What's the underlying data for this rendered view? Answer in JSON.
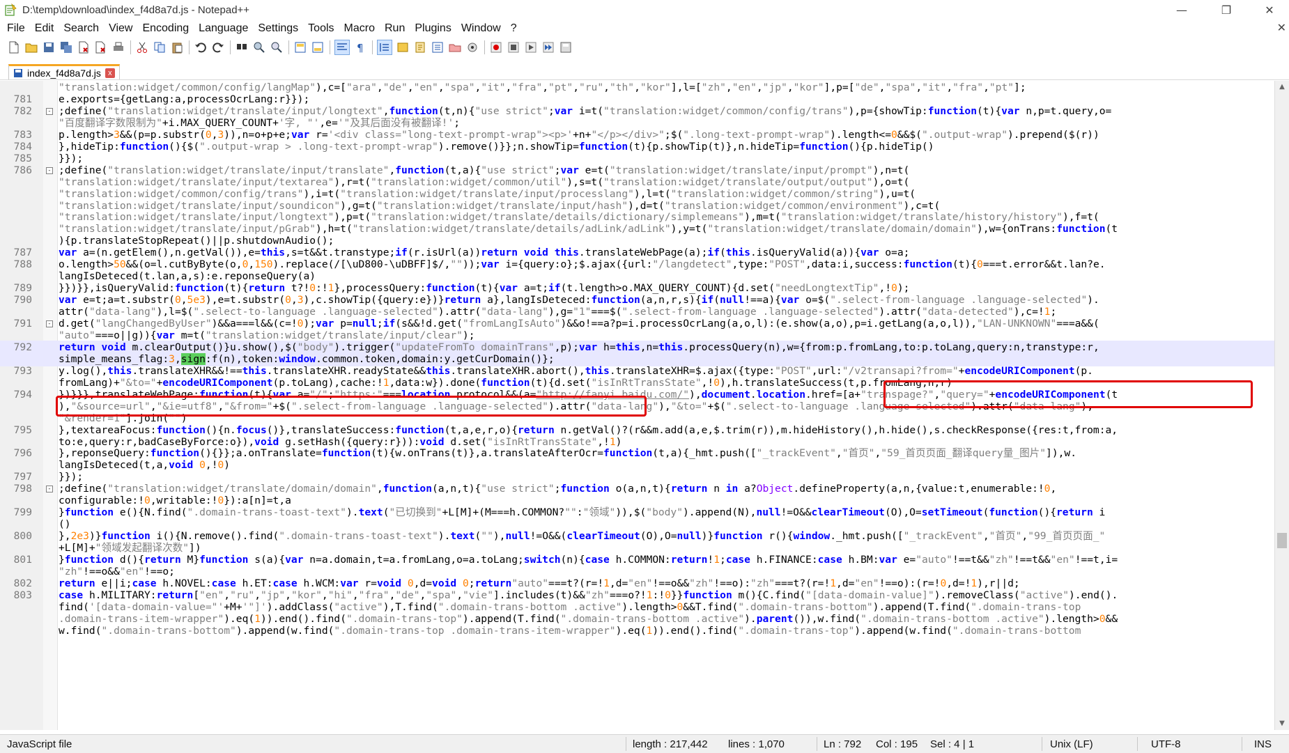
{
  "window": {
    "title": "D:\\temp\\download\\index_f4d8a7d.js - Notepad++",
    "controls": {
      "minimize": "—",
      "maximize": "❐",
      "close": "✕"
    }
  },
  "menu": {
    "items": [
      "File",
      "Edit",
      "Search",
      "View",
      "Encoding",
      "Language",
      "Settings",
      "Tools",
      "Macro",
      "Run",
      "Plugins",
      "Window",
      "?"
    ],
    "close_glyph": "✕"
  },
  "toolbar": {
    "icons": [
      "new-file-icon",
      "open-file-icon",
      "save-icon",
      "save-all-icon",
      "close-icon",
      "close-all-icon",
      "print-icon",
      "cut-icon",
      "copy-icon",
      "paste-icon",
      "undo-icon",
      "redo-icon",
      "find-icon",
      "replace-icon",
      "zoom-in-icon",
      "zoom-out-icon",
      "sync-vertical-icon",
      "sync-horizontal-icon",
      "word-wrap-icon",
      "show-all-chars-icon",
      "indent-guide-icon",
      "user-lang-icon",
      "doc-map-icon",
      "function-list-icon",
      "folder-workspace-icon",
      "monitor-icon",
      "record-macro-icon",
      "stop-macro-icon",
      "play-macro-icon",
      "play-multiple-icon",
      "save-macro-icon"
    ]
  },
  "tab": {
    "label": "index_f4d8a7d.js",
    "close": "x"
  },
  "editor": {
    "lines": [
      {
        "n": "",
        "fold": "",
        "html": "<span class=\"str\">\"translation:widget/common/config/langMap\"</span>),c=[<span class=\"str\">\"ara\"</span>,<span class=\"str\">\"de\"</span>,<span class=\"str\">\"en\"</span>,<span class=\"str\">\"spa\"</span>,<span class=\"str\">\"it\"</span>,<span class=\"str\">\"fra\"</span>,<span class=\"str\">\"pt\"</span>,<span class=\"str\">\"ru\"</span>,<span class=\"str\">\"th\"</span>,<span class=\"str\">\"kor\"</span>],l=[<span class=\"str\">\"zh\"</span>,<span class=\"str\">\"en\"</span>,<span class=\"str\">\"jp\"</span>,<span class=\"str\">\"kor\"</span>],p=[<span class=\"str\">\"de\"</span>,<span class=\"str\">\"spa\"</span>,<span class=\"str\">\"it\"</span>,<span class=\"str\">\"fra\"</span>,<span class=\"str\">\"pt\"</span>];"
      },
      {
        "n": "781",
        "fold": "",
        "html": "e.exports={getLang:a,processOcrLang:r}});"
      },
      {
        "n": "782",
        "fold": "-",
        "html": ";define(<span class=\"str\">\"translation:widget/translate/input/longtext\"</span>,<span class=\"kw\">function</span>(t,n){<span class=\"str\">\"use strict\"</span>;<span class=\"kw\">var</span> i=t(<span class=\"str\">\"translation:widget/common/config/trans\"</span>),p={showTip:<span class=\"kw\">function</span>(t){<span class=\"kw\">var</span> n,p=t.query,o="
      },
      {
        "n": "",
        "fold": "",
        "html": "<span class=\"str\">\"百度翻译字数限制为\"</span>+i.MAX_QUERY_COUNT+<span class=\"str\">'字, \"'</span>,e=<span class=\"str\">'\"及其后面没有被翻译!'</span>;"
      },
      {
        "n": "783",
        "fold": "",
        "html": "p.length><span class=\"num\">3</span>&&(p=p.substr(<span class=\"num\">0</span>,<span class=\"num\">3</span>)),n=o+p+e;<span class=\"kw\">var</span> r=<span class=\"str\">'&lt;div class=\"long-text-prompt-wrap\"&gt;&lt;p&gt;'</span>+n+<span class=\"str\">\"&lt;/p&gt;&lt;/div&gt;\"</span>;$(<span class=\"str\">\".long-text-prompt-wrap\"</span>).length&lt;=<span class=\"num\">0</span>&&$(<span class=\"str\">\".output-wrap\"</span>).prepend($(r))"
      },
      {
        "n": "784",
        "fold": "",
        "html": "},hideTip:<span class=\"kw\">function</span>(){$(<span class=\"str\">\".output-wrap &gt; .long-text-prompt-wrap\"</span>).remove()}};n.showTip=<span class=\"kw\">function</span>(t){p.showTip(t)},n.hideTip=<span class=\"kw\">function</span>(){p.hideTip()"
      },
      {
        "n": "785",
        "fold": "",
        "html": "}});"
      },
      {
        "n": "786",
        "fold": "-",
        "html": ";define(<span class=\"str\">\"translation:widget/translate/input/translate\"</span>,<span class=\"kw\">function</span>(t,a){<span class=\"str\">\"use strict\"</span>;<span class=\"kw\">var</span> e=t(<span class=\"str\">\"translation:widget/translate/input/prompt\"</span>),n=t("
      },
      {
        "n": "",
        "fold": "",
        "html": "<span class=\"str\">\"translation:widget/translate/input/textarea\"</span>),r=t(<span class=\"str\">\"translation:widget/common/util\"</span>),s=t(<span class=\"str\">\"translation:widget/translate/output/output\"</span>),o=t("
      },
      {
        "n": "",
        "fold": "",
        "html": "<span class=\"str\">\"translation:widget/common/config/trans\"</span>),i=t(<span class=\"str\">\"translation:widget/translate/input/processlang\"</span>),l=t(<span class=\"str\">\"translation:widget/common/string\"</span>),u=t("
      },
      {
        "n": "",
        "fold": "",
        "html": "<span class=\"str\">\"translation:widget/translate/input/soundicon\"</span>),g=t(<span class=\"str\">\"translation:widget/translate/input/hash\"</span>),d=t(<span class=\"str\">\"translation:widget/common/environment\"</span>),c=t("
      },
      {
        "n": "",
        "fold": "",
        "html": "<span class=\"str\">\"translation:widget/translate/input/longtext\"</span>),p=t(<span class=\"str\">\"translation:widget/translate/details/dictionary/simplemeans\"</span>),m=t(<span class=\"str\">\"translation:widget/translate/history/history\"</span>),f=t("
      },
      {
        "n": "",
        "fold": "",
        "html": "<span class=\"str\">\"translation:widget/translate/input/pGrab\"</span>),h=t(<span class=\"str\">\"translation:widget/translate/details/adLink/adLink\"</span>),y=t(<span class=\"str\">\"translation:widget/translate/domain/domain\"</span>),w={onTrans:<span class=\"kw\">function</span>(t"
      },
      {
        "n": "",
        "fold": "",
        "html": "){p.translateStopRepeat()||p.shutdownAudio();"
      },
      {
        "n": "787",
        "fold": "",
        "html": "<span class=\"kw\">var</span> a=(n.getElem(),n.getVal()),e=<span class=\"kw\">this</span>,s=t&&t.transtype;<span class=\"kw\">if</span>(r.isUrl(a))<span class=\"kw\">return</span> <span class=\"kw\">void</span> <span class=\"kw\">this</span>.translateWebPage(a);<span class=\"kw\">if</span>(<span class=\"kw\">this</span>.isQueryValid(a)){<span class=\"kw\">var</span> o=a;"
      },
      {
        "n": "788",
        "fold": "",
        "html": "o.length&gt;<span class=\"num\">50</span>&&(o=l.cutByByte(o,<span class=\"num\">0</span>,<span class=\"num\">150</span>).replace(/[\\uD800-\\uDBFF]$/,<span class=\"str\">\"\"</span>));<span class=\"kw\">var</span> i={query:o};$.ajax({url:<span class=\"str\">\"/langdetect\"</span>,type:<span class=\"str\">\"POST\"</span>,data:i,success:<span class=\"kw\">function</span>(t){<span class=\"num\">0</span>===t.error&&t.lan?e."
      },
      {
        "n": "",
        "fold": "",
        "html": "langIsDeteced(t.lan,a,s):e.reponseQuery(a)"
      },
      {
        "n": "789",
        "fold": "",
        "html": "}})}},isQueryValid:<span class=\"kw\">function</span>(t){<span class=\"kw\">return</span> t?!<span class=\"num\">0</span>:!<span class=\"num\">1</span>},processQuery:<span class=\"kw\">function</span>(t){<span class=\"kw\">var</span> a=t;<span class=\"kw\">if</span>(t.length&gt;o.MAX_QUERY_COUNT){d.set(<span class=\"str\">\"needLongtextTip\"</span>,!<span class=\"num\">0</span>);"
      },
      {
        "n": "790",
        "fold": "",
        "html": "<span class=\"kw\">var</span> e=t;a=t.substr(<span class=\"num\">0</span>,<span class=\"num\">5e3</span>),e=t.substr(<span class=\"num\">0</span>,<span class=\"num\">3</span>),c.showTip({query:e})}<span class=\"kw\">return</span> a},langIsDeteced:<span class=\"kw\">function</span>(a,n,r,s){<span class=\"kw\">if</span>(<span class=\"kw\">null</span>!==a){<span class=\"kw\">var</span> o=$(<span class=\"str\">\".select-from-language .language-selected\"</span>)."
      },
      {
        "n": "",
        "fold": "",
        "html": "attr(<span class=\"str\">\"data-lang\"</span>),l=$(<span class=\"str\">\".select-to-language .language-selected\"</span>).attr(<span class=\"str\">\"data-lang\"</span>),g=<span class=\"str\">\"1\"</span>===$(<span class=\"str\">\".select-from-language .language-selected\"</span>).attr(<span class=\"str\">\"data-detected\"</span>),c=!<span class=\"num\">1</span>;"
      },
      {
        "n": "791",
        "fold": "-",
        "html": "d.get(<span class=\"str\">\"langChangedByUser\"</span>)&&a===l&&(c=!<span class=\"num\">0</span>);<span class=\"kw\">var</span> p=<span class=\"kw\">null</span>;<span class=\"kw\">if</span>(s&&!d.get(<span class=\"str\">\"fromLangIsAuto\"</span>)&&o!==a?p=i.processOcrLang(a,o,l):(e.show(a,o),p=i.getLang(a,o,l)),<span class=\"str\">\"LAN-UNKNOWN\"</span>===a&&("
      },
      {
        "n": "",
        "fold": "",
        "html": "<span class=\"str\">\"auto\"</span>===o||g)){<span class=\"kw\">var</span> m=t(<span class=\"str\">\"translation:widget/translate/input/clear\"</span>);"
      },
      {
        "n": "792",
        "fold": "",
        "caret": true,
        "html": "<span class=\"kw\">return</span> <span class=\"kw\">void</span> m.clearOutput()}u.show(),$(<span class=\"str\">\"body\"</span>).trigger(<span class=\"str\">\"updateFromTo_domainTrans\"</span>,p);<span class=\"kw\">var</span> h=<span class=\"kw\">this</span>,n=<span class=\"kw\">this</span>.processQuery(n),w={from:p.fromLang,to:p.toLang,query:n,transtype:r,"
      },
      {
        "n": "",
        "fold": "",
        "caret": true,
        "html": "simple_means_flag:<span class=\"num\">3</span>,<span class=\"sign-hl\">sign</span>:f(n),token:<span class=\"kw\">window</span>.common.token,domain:y.getCurDomain()};"
      },
      {
        "n": "793",
        "fold": "",
        "html": "y.log(),<span class=\"kw\">this</span>.translateXHR&&!==<span class=\"kw\">this</span>.translateXHR.readyState&&<span class=\"kw\">this</span>.translateXHR.abort(),<span class=\"kw\">this</span>.translateXHR=$.ajax({type:<span class=\"str\">\"POST\"</span>,url:<span class=\"str\">\"/v2transapi?from=\"</span>+<span class=\"kw\">encodeURIComponent</span>(p."
      },
      {
        "n": "",
        "fold": "",
        "html": "fromLang)+<span class=\"str\">\"&to=\"</span>+<span class=\"kw\">encodeURIComponent</span>(p.toLang),cache:!<span class=\"num\">1</span>,data:w}).done(<span class=\"kw\">function</span>(t){d.set(<span class=\"str\">\"isInRtTransState\"</span>,!<span class=\"num\">0</span>),h.translateSuccess(t,p.fromLang,n,r)"
      },
      {
        "n": "794",
        "fold": "",
        "html": "})}}},translateWebPage:<span class=\"kw\">function</span>(t){<span class=\"kw\">var</span> a=<span class=\"str\">\"/\"</span>;<span class=\"str\">\"https:\"</span>===<span class=\"kw\">location</span>.protocol&&(a=<span class=\"str\" style=\"text-decoration:underline\">\"http://fanyi.baidu.com/\"</span>),<span class=\"kw\">document</span>.<span class=\"kw\">location</span>.href=[a+<span class=\"str\">\"transpage?\"</span>,<span class=\"str\">\"query=\"</span>+<span class=\"kw\">encodeURIComponent</span>(t"
      },
      {
        "n": "",
        "fold": "",
        "html": "),<span class=\"str\">\"&source=url\"</span>,<span class=\"str\">\"&ie=utf8\"</span>,<span class=\"str\">\"&from=\"</span>+$(<span class=\"str\">\".select-from-language .language-selected\"</span>).attr(<span class=\"str\">\"data-lang\"</span>),<span class=\"str\">\"&to=\"</span>+$(<span class=\"str\">\".select-to-language .language-selected\"</span>).attr(<span class=\"str\">\"data-lang\"</span>),"
      },
      {
        "n": "",
        "fold": "",
        "html": "<span class=\"str\">\"&render=1\"</span>].join(<span class=\"str\">\"\"</span>)"
      },
      {
        "n": "795",
        "fold": "",
        "html": "},textareaFocus:<span class=\"kw\">function</span>(){n.<span class=\"kw\">focus</span>()},translateSuccess:<span class=\"kw\">function</span>(t,a,e,r,o){<span class=\"kw\">return</span> n.getVal()?(r&&m.add(a,e,$.trim(r)),m.hideHistory(),h.hide(),s.checkResponse({res:t,from:a,"
      },
      {
        "n": "",
        "fold": "",
        "html": "to:e,query:r,badCaseByForce:o}),<span class=\"kw\">void</span> g.setHash({query:r})):<span class=\"kw\">void</span> d.set(<span class=\"str\">\"isInRtTransState\"</span>,!<span class=\"num\">1</span>)"
      },
      {
        "n": "796",
        "fold": "",
        "html": "},reponseQuery:<span class=\"kw\">function</span>(){}};a.onTranslate=<span class=\"kw\">function</span>(t){w.onTrans(t)},a.translateAfterOcr=<span class=\"kw\">function</span>(t,a){_hmt.push([<span class=\"str\">\"_trackEvent\"</span>,<span class=\"str\">\"首页\"</span>,<span class=\"str\">\"59_首页页面_翻译query量_图片\"</span>]),w."
      },
      {
        "n": "",
        "fold": "",
        "html": "langIsDeteced(t,a,<span class=\"kw\">void</span> <span class=\"num\">0</span>,!<span class=\"num\">0</span>)"
      },
      {
        "n": "797",
        "fold": "",
        "html": "}});"
      },
      {
        "n": "798",
        "fold": "-",
        "html": ";define(<span class=\"str\">\"translation:widget/translate/domain/domain\"</span>,<span class=\"kw\">function</span>(a,n,t){<span class=\"str\">\"use strict\"</span>;<span class=\"kw\">function</span> o(a,n,t){<span class=\"kw\">return</span> n <span class=\"kw\">in</span> a?<span style=\"color:#8000ff\">Object</span>.defineProperty(a,n,{value:t,enumerable:!<span class=\"num\">0</span>,"
      },
      {
        "n": "",
        "fold": "",
        "html": "configurable:!<span class=\"num\">0</span>,writable:!<span class=\"num\">0</span>}):a[n]=t,a"
      },
      {
        "n": "799",
        "fold": "",
        "html": "}<span class=\"kw\">function</span> e(){N.find(<span class=\"str\">\".domain-trans-toast-text\"</span>).<span class=\"kw\">text</span>(<span class=\"str\">\"已切换到\"</span>+L[M]+(M===h.COMMON?<span class=\"str\">\"\"</span>:<span class=\"str\">\"领域\"</span>)),$(<span class=\"str\">\"body\"</span>).append(N),<span class=\"kw\">null</span>!=O&&<span class=\"kw\">clearTimeout</span>(O),O=<span class=\"kw\">setTimeout</span>(<span class=\"kw\">function</span>(){<span class=\"kw\">return</span> i"
      },
      {
        "n": "",
        "fold": "",
        "html": "()"
      },
      {
        "n": "800",
        "fold": "",
        "html": "},<span class=\"num\">2e3</span>)}<span class=\"kw\">function</span> i(){N.remove().find(<span class=\"str\">\".domain-trans-toast-text\"</span>).<span class=\"kw\">text</span>(<span class=\"str\">\"\"</span>),<span class=\"kw\">null</span>!=O&&(<span class=\"kw\">clearTimeout</span>(O),O=<span class=\"kw\">null</span>)}<span class=\"kw\">function</span> r(){<span class=\"kw\">window</span>._hmt.push([<span class=\"str\">\"_trackEvent\"</span>,<span class=\"str\">\"首页\"</span>,<span class=\"str\">\"99_首页页面_\"</span>"
      },
      {
        "n": "",
        "fold": "",
        "html": "+L[M]+<span class=\"str\">\"领域发起翻译次数\"</span>])"
      },
      {
        "n": "801",
        "fold": "",
        "html": "}<span class=\"kw\">function</span> d(){<span class=\"kw\">return</span> M}<span class=\"kw\">function</span> s(a){<span class=\"kw\">var</span> n=a.domain,t=a.fromLang,o=a.toLang;<span class=\"kw\">switch</span>(n){<span class=\"kw\">case</span> h.COMMON:<span class=\"kw\">return</span>!<span class=\"num\">1</span>;<span class=\"kw\">case</span> h.FINANCE:<span class=\"kw\">case</span> h.BM:<span class=\"kw\">var</span> e=<span class=\"str\">\"auto\"</span>!==t&&<span class=\"str\">\"zh\"</span>!==t&&<span class=\"str\">\"en\"</span>!==t,i="
      },
      {
        "n": "",
        "fold": "",
        "html": "<span class=\"str\">\"zh\"</span>!==o&&<span class=\"str\">\"en\"</span>!==o;"
      },
      {
        "n": "802",
        "fold": "",
        "html": "<span class=\"kw\">return</span> e||i;<span class=\"kw\">case</span> h.NOVEL:<span class=\"kw\">case</span> h.ET:<span class=\"kw\">case</span> h.WCM:<span class=\"kw\">var</span> r=<span class=\"kw\">void</span> <span class=\"num\">0</span>,d=<span class=\"kw\">void</span> <span class=\"num\">0</span>;<span class=\"kw\">return</span><span class=\"str\">\"auto\"</span>===t?(r=!<span class=\"num\">1</span>,d=<span class=\"str\">\"en\"</span>!==o&&<span class=\"str\">\"zh\"</span>!==o):<span class=\"str\">\"zh\"</span>===t?(r=!<span class=\"num\">1</span>,d=<span class=\"str\">\"en\"</span>!==o):(r=!<span class=\"num\">0</span>,d=!<span class=\"num\">1</span>),r||d;"
      },
      {
        "n": "803",
        "fold": "",
        "html": "<span class=\"kw\">case</span> h.MILITARY:<span class=\"kw\">return</span>[<span class=\"str\">\"en\"</span>,<span class=\"str\">\"ru\"</span>,<span class=\"str\">\"jp\"</span>,<span class=\"str\">\"kor\"</span>,<span class=\"str\">\"hi\"</span>,<span class=\"str\">\"fra\"</span>,<span class=\"str\">\"de\"</span>,<span class=\"str\">\"spa\"</span>,<span class=\"str\">\"vie\"</span>].includes(t)&&<span class=\"str\">\"zh\"</span>===o?!<span class=\"num\">1</span>:!<span class=\"num\">0</span>}}<span class=\"kw\">function</span> m(){C.find(<span class=\"str\">\"[data-domain-value]\"</span>).removeClass(<span class=\"str\">\"active\"</span>).end()."
      },
      {
        "n": "",
        "fold": "",
        "html": "find(<span class=\"str\">'[data-domain-value=\"'</span>+M+<span class=\"str\">'\"]'</span>).addClass(<span class=\"str\">\"active\"</span>),T.find(<span class=\"str\">\".domain-trans-bottom .active\"</span>).length&gt;<span class=\"num\">0</span>&&T.find(<span class=\"str\">\".domain-trans-bottom\"</span>).append(T.find(<span class=\"str\">\".domain-trans-top</span>"
      },
      {
        "n": "",
        "fold": "",
        "html": "<span class=\"str\">.domain-trans-item-wrapper\"</span>).eq(<span class=\"num\">1</span>)).end().find(<span class=\"str\">\".domain-trans-top\"</span>).append(T.find(<span class=\"str\">\".domain-trans-bottom .active\"</span>).<span class=\"kw\">parent</span>()),w.find(<span class=\"str\">\".domain-trans-bottom .active\"</span>).length&gt;<span class=\"num\">0</span>&&"
      },
      {
        "n": "",
        "fold": "",
        "html": "w.find(<span class=\"str\">\".domain-trans-bottom\"</span>).append(w.find(<span class=\"str\">\".domain-trans-top .domain-trans-item-wrapper\"</span>).eq(<span class=\"num\">1</span>)).end().find(<span class=\"str\">\".domain-trans-top\"</span>).append(w.find(<span class=\"str\">\".domain-trans-bottom"
      }
    ]
  },
  "status": {
    "file_type": "JavaScript file",
    "length": "length : 217,442",
    "lines": "lines : 1,070",
    "ln": "Ln : 792",
    "col": "Col : 195",
    "sel": "Sel : 4 | 1",
    "eol": "Unix (LF)",
    "encoding": "UTF-8",
    "mode": "INS"
  },
  "colors": {
    "highlight_box": "#e00000",
    "sign_highlight": "#5ccf5c",
    "tab_accent": "#f5a623"
  }
}
